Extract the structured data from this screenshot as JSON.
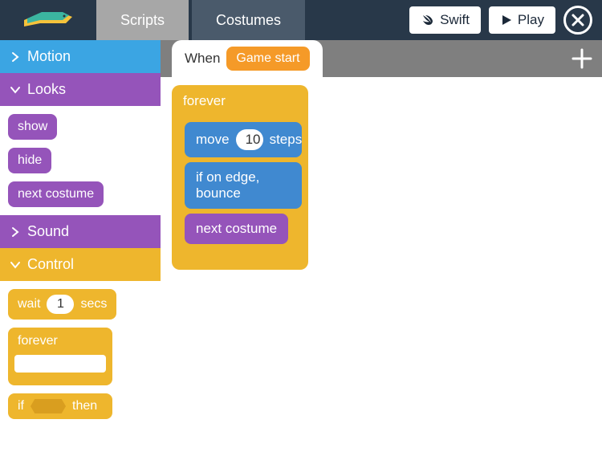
{
  "header": {
    "tabs": {
      "scripts": "Scripts",
      "costumes": "Costumes"
    },
    "swift_label": "Swift",
    "play_label": "Play"
  },
  "sidebar": {
    "motion": {
      "label": "Motion"
    },
    "looks": {
      "label": "Looks",
      "blocks": {
        "show": "show",
        "hide": "hide",
        "next_costume": "next costume"
      }
    },
    "sound": {
      "label": "Sound"
    },
    "control": {
      "label": "Control",
      "wait": {
        "prefix": "wait",
        "value": "1",
        "suffix": "secs"
      },
      "forever": "forever",
      "if_then": {
        "prefix": "if",
        "suffix": "then"
      }
    }
  },
  "canvas": {
    "hat": {
      "when": "When",
      "event": "Game start"
    },
    "script": {
      "forever": "forever",
      "move": {
        "prefix": "move",
        "value": "10",
        "suffix": "steps"
      },
      "bounce": "if on edge, bounce",
      "next_costume": "next costume"
    }
  }
}
